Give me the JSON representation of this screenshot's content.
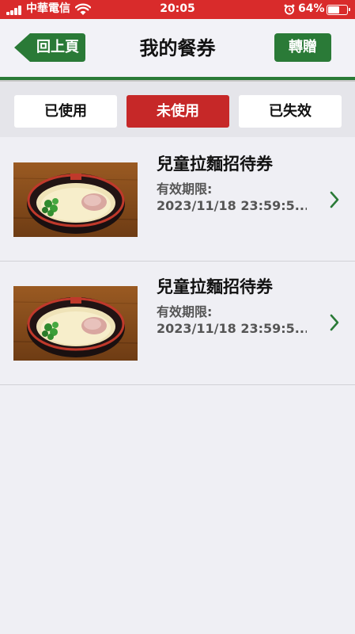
{
  "status_bar": {
    "carrier": "中華電信",
    "time": "20:05",
    "battery_percent": "64%",
    "battery_level": 0.64,
    "color": "#d92b2b"
  },
  "nav": {
    "title": "我的餐券",
    "back_label": "回上頁",
    "gift_label": "轉贈",
    "accent_color": "#2a7a37"
  },
  "tabs": [
    {
      "label": "已使用",
      "active": false
    },
    {
      "label": "未使用",
      "active": true
    },
    {
      "label": "已失效",
      "active": false
    }
  ],
  "coupons": [
    {
      "name": "兒童拉麵招待券",
      "validity_label": "有效期限:",
      "validity_value": "2023/11/18 23:59:5...",
      "image": "ramen-bowl",
      "icon": "chevron-right-icon"
    },
    {
      "name": "兒童拉麵招待券",
      "validity_label": "有效期限:",
      "validity_value": "2023/11/18 23:59:5...",
      "image": "ramen-bowl",
      "icon": "chevron-right-icon"
    }
  ]
}
